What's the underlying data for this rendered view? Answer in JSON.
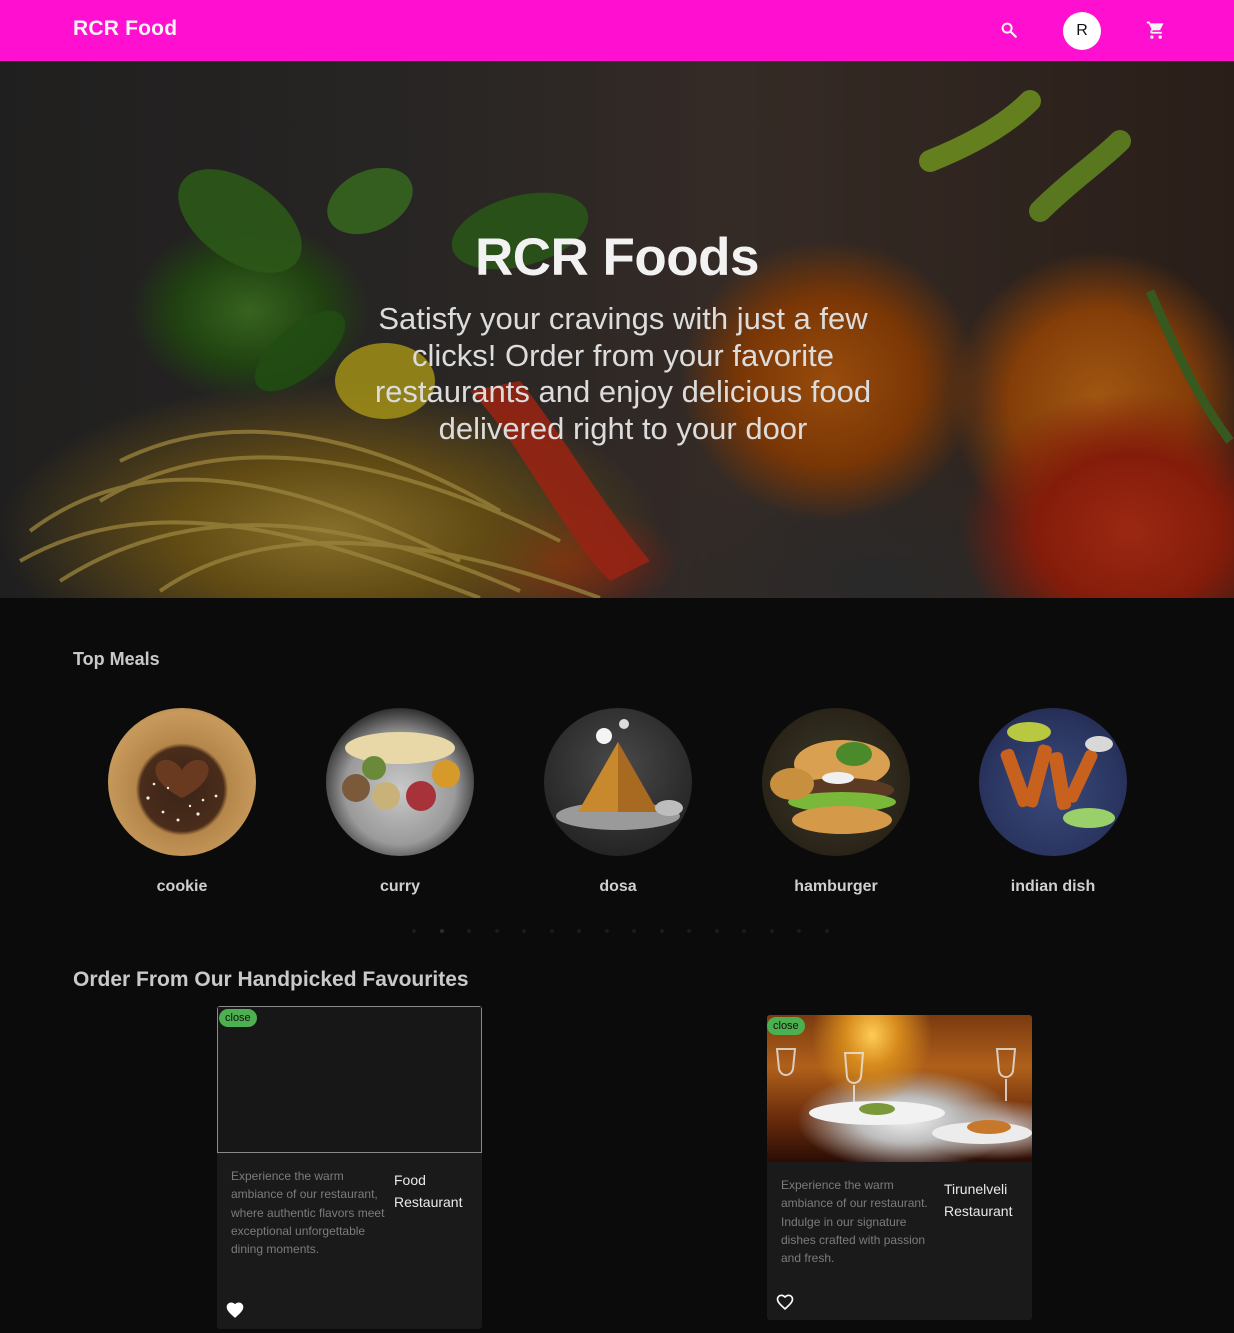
{
  "app_bar": {
    "brand": "RCR Food",
    "background": "#ff10d0",
    "search_icon": "search-icon",
    "avatar_letter": "R",
    "cart_icon": "shopping-cart-icon"
  },
  "hero": {
    "title": "RCR Foods",
    "subtitle": "Satisfy your cravings with just a few clicks! Order from your favorite restaurants and enjoy delicious food delivered right to your door"
  },
  "top_meals": {
    "title": "Top Meals",
    "items": [
      {
        "label": "cookie"
      },
      {
        "label": "curry"
      },
      {
        "label": "dosa"
      },
      {
        "label": "hamburger"
      },
      {
        "label": "indian dish"
      }
    ],
    "carousel_pages": 16,
    "active_page": 2
  },
  "favourites": {
    "title": "Order From Our Handpicked Favourites",
    "restaurants": [
      {
        "status": "close",
        "name": "Food Restaurant",
        "description": "Experience the warm ambiance of our restaurant, where authentic flavors meet exceptional unforgettable dining moments.",
        "favorited": true,
        "status_color": "#4caf50"
      },
      {
        "status": "close",
        "name": "Tirunelveli Restaurant",
        "description": "Experience the warm ambiance of our restaurant. Indulge in our signature dishes crafted with passion and fresh.",
        "favorited": false,
        "status_color": "#4caf50"
      }
    ]
  }
}
